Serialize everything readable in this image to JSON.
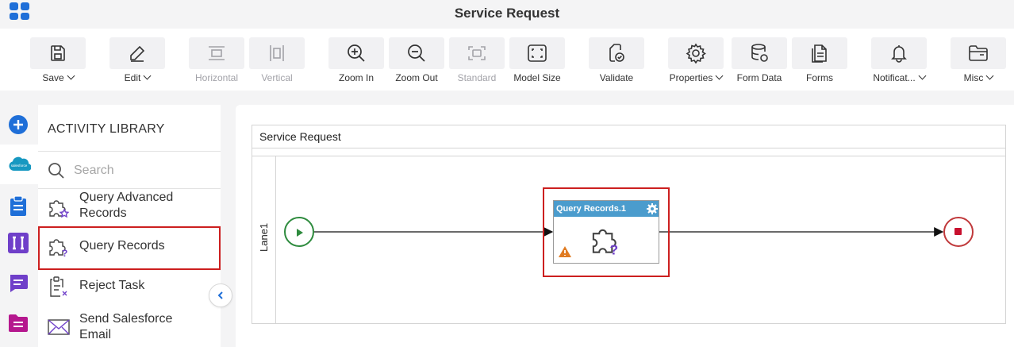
{
  "app": {
    "title": "Service Request",
    "accent": "#1f6fd8"
  },
  "toolbar": {
    "save": "Save",
    "edit": "Edit",
    "horizontal": "Horizontal",
    "vertical": "Vertical",
    "zoom_in": "Zoom In",
    "zoom_out": "Zoom Out",
    "standard": "Standard",
    "model_size": "Model Size",
    "validate": "Validate",
    "properties": "Properties",
    "form_data": "Form Data",
    "forms": "Forms",
    "notifications": "Notificat...",
    "misc": "Misc"
  },
  "leftnav": {
    "icons": [
      "add-icon",
      "salesforce-icon",
      "clipboard-icon",
      "bracket-icon",
      "chat-icon",
      "document-icon"
    ],
    "salesforce_text": "salesforce"
  },
  "library": {
    "title": "ACTIVITY LIBRARY",
    "search_placeholder": "Search",
    "items": [
      {
        "label": "Query Advanced\nRecords",
        "line1": "Query Advanced",
        "line2": "Records",
        "icon": "puzzle-star-icon"
      },
      {
        "label": "Query Records",
        "icon": "puzzle-question-icon"
      },
      {
        "label": "Reject Task",
        "icon": "clipboard-x-icon"
      },
      {
        "label": "Send Salesforce Email",
        "line1": "Send Salesforce",
        "line2": "Email",
        "icon": "envelope-icon"
      }
    ]
  },
  "canvas": {
    "pool_title": "Service Request",
    "lane_label": "Lane1",
    "task_title": "Query Records.1",
    "colors": {
      "start": "#2e8b3e",
      "end": "#c0393b",
      "task_header": "#4b9ccd",
      "warning": "#e07b22"
    }
  }
}
